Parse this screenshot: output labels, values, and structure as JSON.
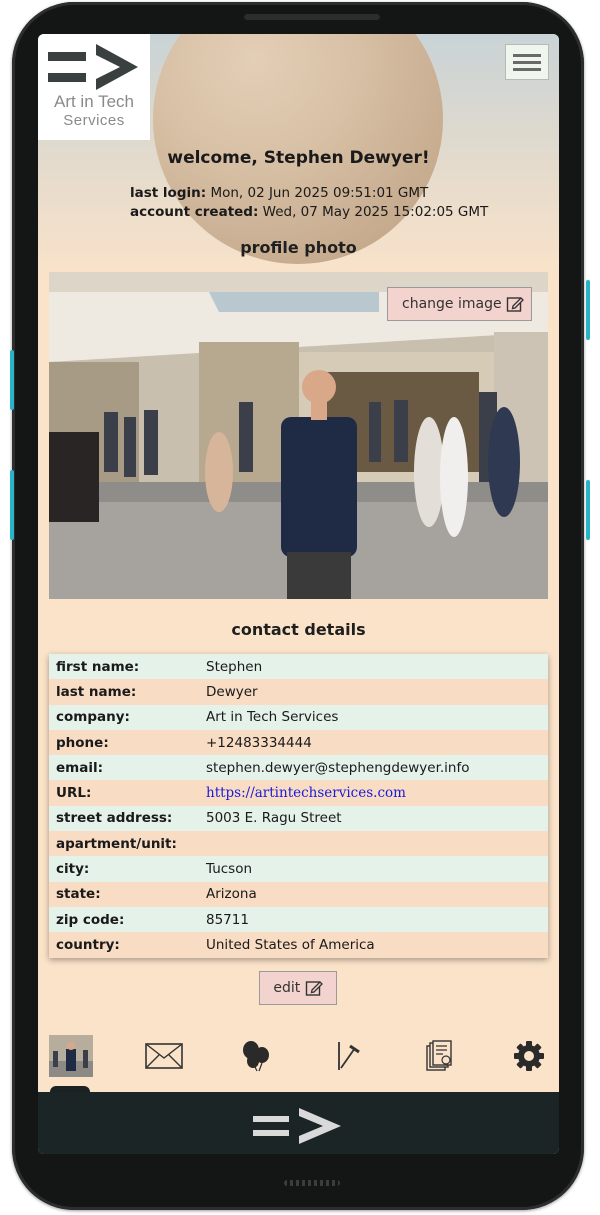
{
  "logo": {
    "line1": "Art in Tech",
    "line2": "Services"
  },
  "header": {
    "welcome": "welcome, Stephen Dewyer!",
    "last_login_label": "last login:",
    "last_login_value": "Mon, 02 Jun 2025 09:51:01 GMT",
    "created_label": "account created:",
    "created_value": "Wed, 07 May 2025 15:02:05 GMT"
  },
  "profile": {
    "heading": "profile photo",
    "change_image_label": "change image"
  },
  "contact": {
    "heading": "contact details",
    "rows": [
      {
        "label": "first name:",
        "value": "Stephen"
      },
      {
        "label": "last name:",
        "value": "Dewyer"
      },
      {
        "label": "company:",
        "value": "Art in Tech Services"
      },
      {
        "label": "phone:",
        "value": "+12483334444"
      },
      {
        "label": "email:",
        "value": "stephen.dewyer@stephengdewyer.info"
      },
      {
        "label": "URL:",
        "value": "https://artintechservices.com"
      },
      {
        "label": "street address:",
        "value": "5003 E. Ragu Street"
      },
      {
        "label": "apartment/unit:",
        "value": ""
      },
      {
        "label": "city:",
        "value": "Tucson"
      },
      {
        "label": "state:",
        "value": "Arizona"
      },
      {
        "label": "zip code:",
        "value": "85711"
      },
      {
        "label": "country:",
        "value": "United States of America"
      }
    ],
    "edit_label": "edit"
  },
  "nav": {
    "items": [
      "profile-thumbnail-icon",
      "envelope-icon",
      "balloons-icon",
      "tools-icon",
      "invoices-icon",
      "gear-icon"
    ]
  },
  "colors": {
    "background": "#fbe3ca",
    "row_odd": "#e4f2ea",
    "row_even": "#f8dcc3",
    "button": "#f3d3cd",
    "footer": "#1c2526",
    "link": "#1a1adb"
  }
}
